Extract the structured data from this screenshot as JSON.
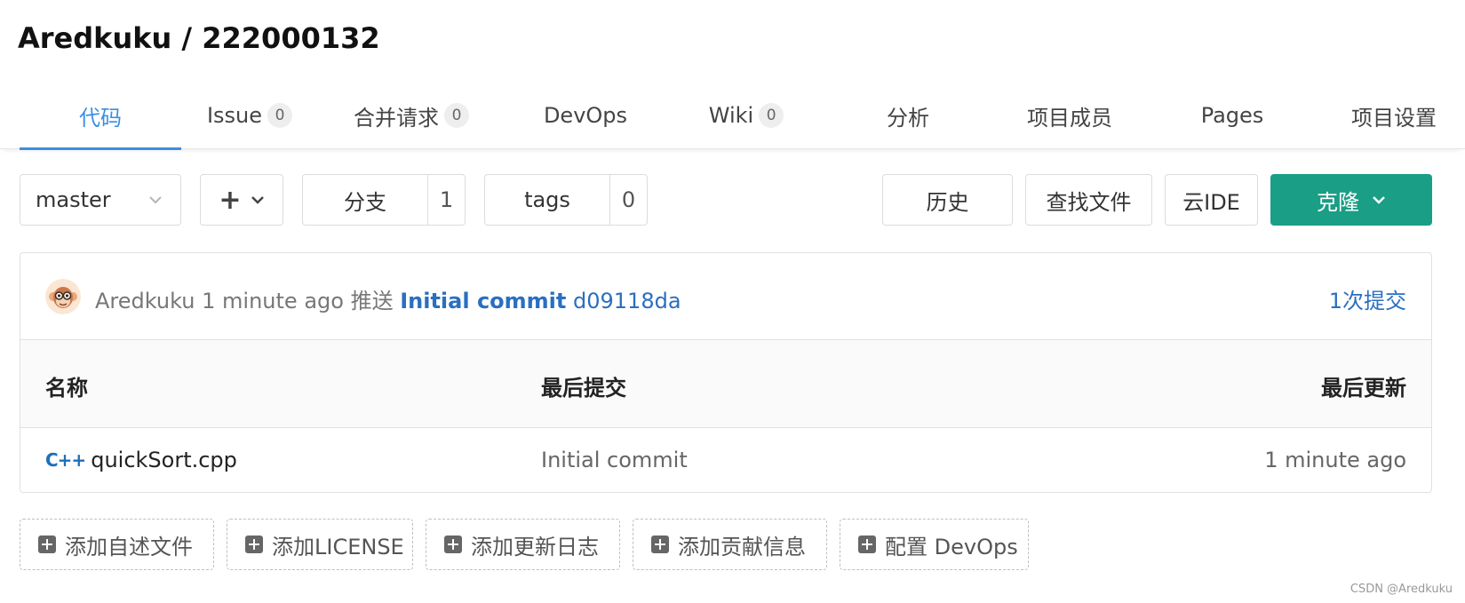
{
  "repo": {
    "title": "Aredkuku / 222000132"
  },
  "tabs": [
    {
      "label": "代码",
      "count": null,
      "active": true
    },
    {
      "label": "Issue",
      "count": "0"
    },
    {
      "label": "合并请求",
      "count": "0"
    },
    {
      "label": "DevOps",
      "count": null
    },
    {
      "label": "Wiki",
      "count": "0"
    },
    {
      "label": "分析",
      "count": null
    },
    {
      "label": "项目成员",
      "count": null
    },
    {
      "label": "Pages",
      "count": null
    },
    {
      "label": "项目设置",
      "count": null
    }
  ],
  "toolbar": {
    "branch": "master",
    "plus_symbol": "+",
    "branches_label": "分支",
    "branches_count": "1",
    "tags_label": "tags",
    "tags_count": "0",
    "history_label": "历史",
    "find_file_label": "查找文件",
    "cloud_ide_label": "云IDE",
    "clone_label": "克隆",
    "clone_color": "#1a9e85"
  },
  "commit": {
    "author": "Aredkuku",
    "time": "1 minute ago",
    "action": "推送",
    "message": "Initial commit",
    "hash": "d09118da",
    "count_label": "1次提交"
  },
  "table": {
    "headers": {
      "name": "名称",
      "last_commit": "最后提交",
      "last_updated": "最后更新"
    },
    "rows": [
      {
        "icon": "C++",
        "name": "quickSort.cpp",
        "commit": "Initial commit",
        "updated": "1 minute ago"
      }
    ]
  },
  "add_buttons": [
    "添加自述文件",
    "添加LICENSE",
    "添加更新日志",
    "添加贡献信息",
    "配置 DevOps"
  ],
  "watermark": "CSDN @Aredkuku",
  "colors": {
    "accent": "#3b8fe0",
    "link": "#2a6fc0"
  }
}
